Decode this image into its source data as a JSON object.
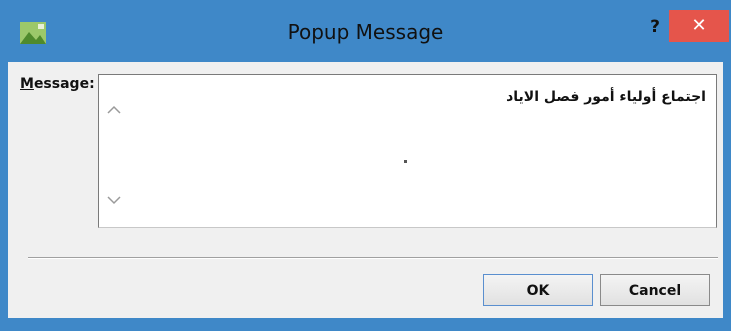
{
  "window": {
    "title": "Popup Message",
    "help_label": "?",
    "close_label": "✕"
  },
  "form": {
    "message_label_accel": "M",
    "message_label_rest": "essage:",
    "message_value": "اجتماع أولياء أمور فصل الاياد"
  },
  "buttons": {
    "ok_label": "OK",
    "cancel_label": "Cancel"
  },
  "colors": {
    "frame": "#3f88c8",
    "close_button": "#e5554b",
    "client_background": "#f0f0f0"
  },
  "icons": {
    "app": "app-picture-icon",
    "scroll_up": "chevron-up-icon",
    "scroll_down": "chevron-down-icon"
  }
}
